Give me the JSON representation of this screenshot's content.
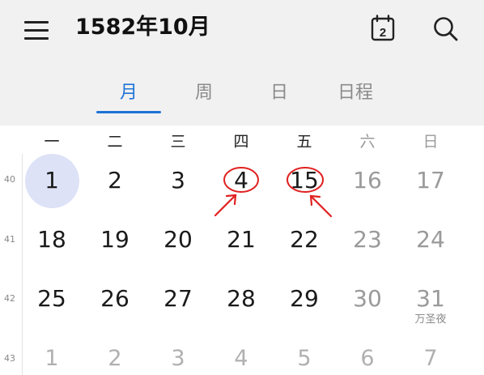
{
  "header": {
    "title": "1582年10月",
    "today_icon_day": "2"
  },
  "tabs": [
    {
      "label": "月",
      "active": true
    },
    {
      "label": "周",
      "active": false
    },
    {
      "label": "日",
      "active": false
    },
    {
      "label": "日程",
      "active": false
    }
  ],
  "weekdays": [
    "一",
    "二",
    "三",
    "四",
    "五",
    "六",
    "日"
  ],
  "weeks": [
    {
      "number": "40",
      "days": [
        "1",
        "2",
        "3",
        "4",
        "15",
        "16",
        "17"
      ]
    },
    {
      "number": "41",
      "days": [
        "18",
        "19",
        "20",
        "21",
        "22",
        "23",
        "24"
      ]
    },
    {
      "number": "42",
      "days": [
        "25",
        "26",
        "27",
        "28",
        "29",
        "30",
        "31"
      ]
    },
    {
      "number": "43",
      "days": [
        "1",
        "2",
        "3",
        "4",
        "5",
        "6",
        "7"
      ]
    }
  ],
  "holiday": {
    "label": "万圣夜"
  },
  "colors": {
    "accent": "#1e73d8",
    "today_highlight": "#dde2f7",
    "annotation": "#e02020",
    "topbar_bg": "#f1f1f1"
  },
  "icons": {
    "menu": "hamburger-menu-icon",
    "today": "calendar-today-icon",
    "search": "search-icon"
  }
}
